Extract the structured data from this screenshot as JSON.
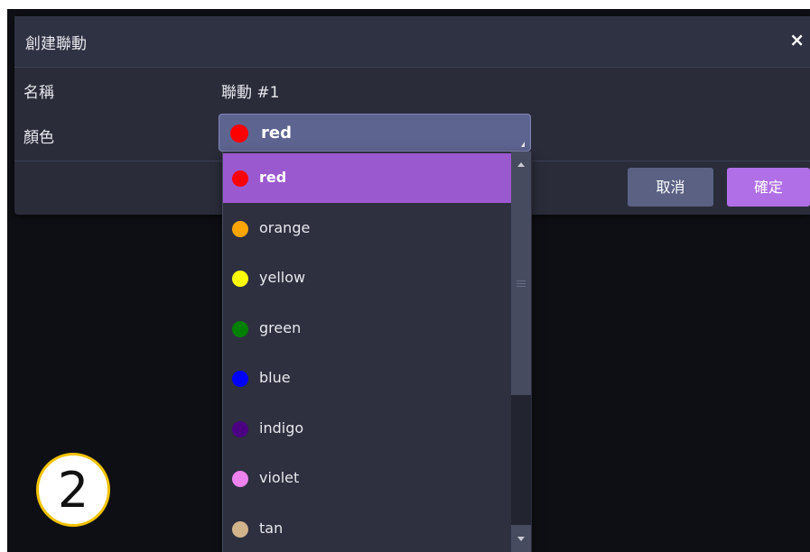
{
  "dialog": {
    "title": "創建聯動",
    "close_label": "×",
    "name_label": "名稱",
    "name_value": "聯動 #1",
    "color_label": "顏色",
    "color_select": {
      "selected": "red",
      "selected_color": "#ff0000"
    },
    "cancel_label": "取消",
    "ok_label": "確定"
  },
  "dropdown": {
    "items": [
      {
        "label": "red",
        "color": "#ff0000",
        "selected": true
      },
      {
        "label": "orange",
        "color": "#ffa500",
        "selected": false
      },
      {
        "label": "yellow",
        "color": "#ffff00",
        "selected": false
      },
      {
        "label": "green",
        "color": "#008000",
        "selected": false
      },
      {
        "label": "blue",
        "color": "#0000ff",
        "selected": false
      },
      {
        "label": "indigo",
        "color": "#4b0082",
        "selected": false
      },
      {
        "label": "violet",
        "color": "#ee82ee",
        "selected": false
      },
      {
        "label": "tan",
        "color": "#d2b48c",
        "selected": false
      }
    ]
  },
  "step_badge": {
    "number": "2"
  },
  "colors": {
    "accent": "#b06fe6",
    "selected_item_bg": "#9b59d0",
    "dialog_bg": "#2a2c3a",
    "select_bg": "#5d6490"
  }
}
